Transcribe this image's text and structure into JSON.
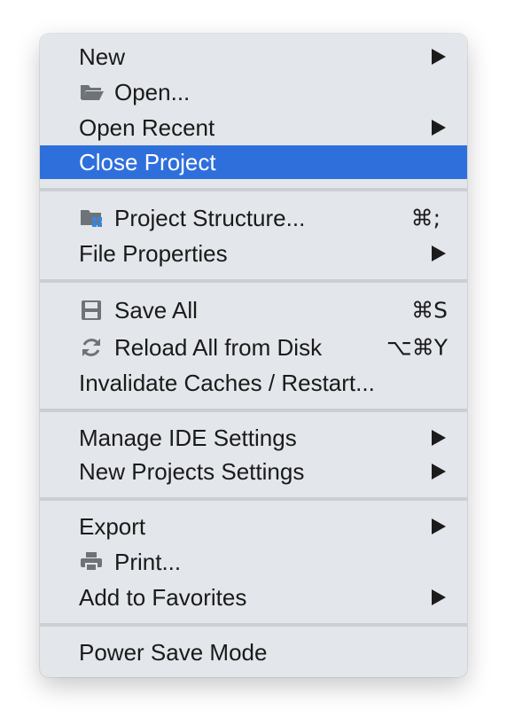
{
  "menu": {
    "items": [
      {
        "label": "New",
        "submenu": true
      },
      {
        "label": "Open...",
        "icon": "folder-open-icon"
      },
      {
        "label": "Open Recent",
        "submenu": true
      },
      {
        "label": "Close Project",
        "selected": true
      },
      {
        "label": "Project Structure...",
        "icon": "project-structure-icon",
        "shortcut": "⌘;"
      },
      {
        "label": "File Properties",
        "submenu": true
      },
      {
        "label": "Save All",
        "icon": "save-icon",
        "shortcut": "⌘S"
      },
      {
        "label": "Reload All from Disk",
        "icon": "reload-icon",
        "shortcut": "⌥⌘Y"
      },
      {
        "label": "Invalidate Caches / Restart..."
      },
      {
        "label": "Manage IDE Settings",
        "submenu": true
      },
      {
        "label": "New Projects Settings",
        "submenu": true
      },
      {
        "label": "Export",
        "submenu": true
      },
      {
        "label": "Print...",
        "icon": "print-icon"
      },
      {
        "label": "Add to Favorites",
        "submenu": true
      },
      {
        "label": "Power Save Mode"
      }
    ]
  },
  "colors": {
    "menu_background": "#e3e6ea",
    "selection": "#2f6fdc",
    "separator": "#cbcfd4",
    "text": "#1a1a1a",
    "icon": "#6e7378",
    "icon_accent": "#3a86d8"
  }
}
